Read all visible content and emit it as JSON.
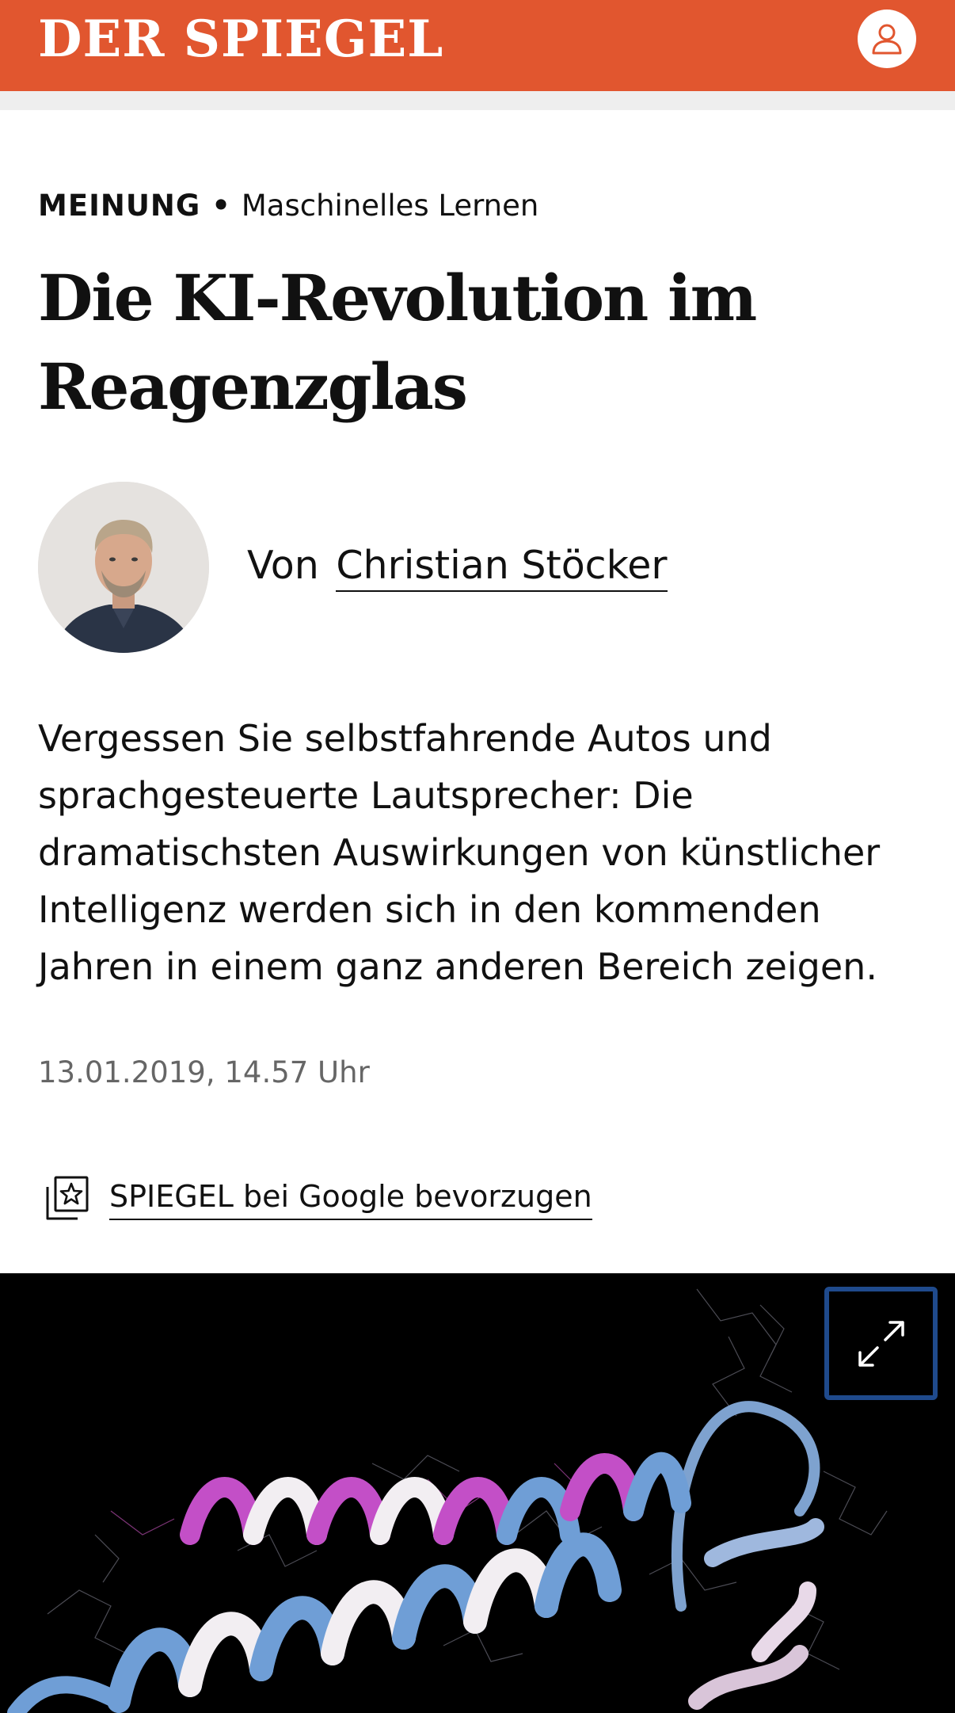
{
  "header": {
    "logo_text": "DER SPIEGEL",
    "account_icon": "user-icon",
    "brand_color": "#e1562f"
  },
  "article": {
    "channel": "MEINUNG",
    "separator": "•",
    "topic": "Maschinelles Lernen",
    "headline_line1": "Die KI-Revolution im",
    "headline_line2": "Reagenzglas",
    "byline_prefix": "Von",
    "author": "Christian Stöcker",
    "teaser": "Vergessen Sie selbstfahrende Autos und sprachgesteuerte Lautsprecher: Die dramatischsten Auswirkungen von künstlicher Intelligenz werden sich in den kommenden Jahren in einem ganz anderen Bereich zeigen.",
    "timestamp": "13.01.2019, 14.57 Uhr"
  },
  "google_preference": {
    "icon": "star-bookmark-icon",
    "label": "SPIEGEL bei Google bevorzugen"
  },
  "hero_image": {
    "subject": "protein-structure-image",
    "expand_icon": "expand-icon"
  }
}
